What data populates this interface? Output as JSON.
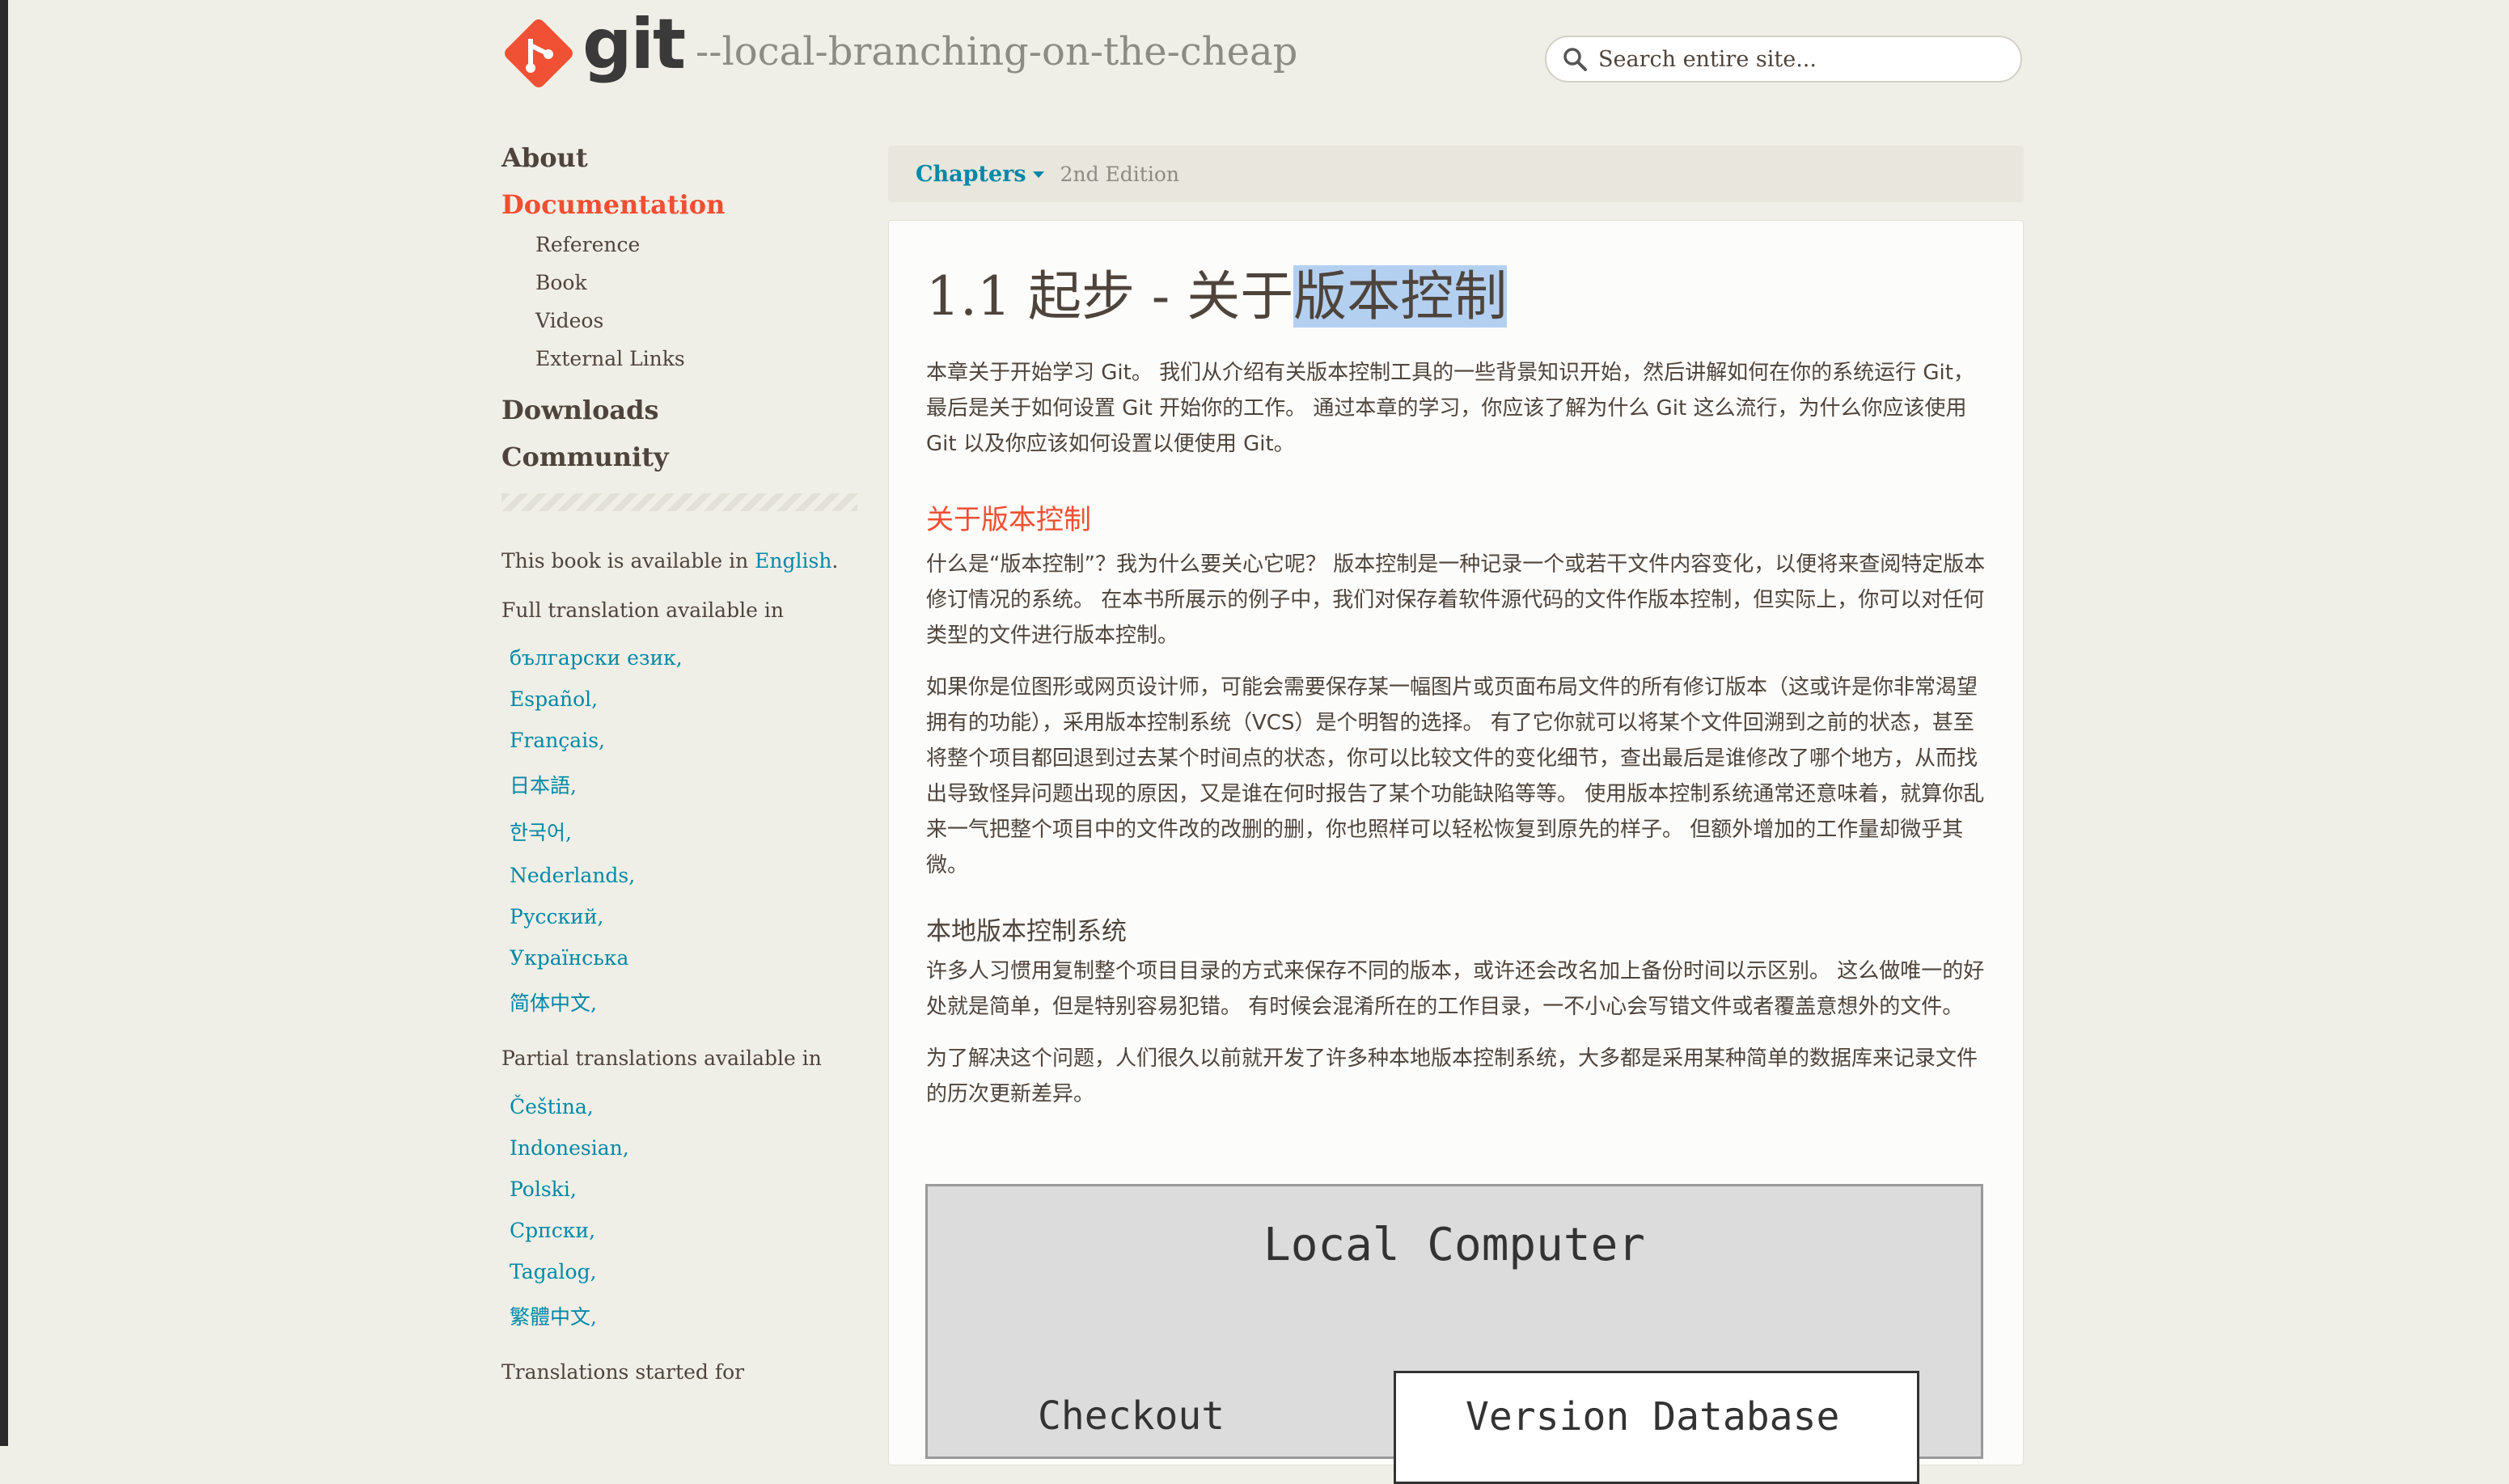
{
  "brand": {
    "logo_text": "git",
    "tagline": "--local-branching-on-the-cheap",
    "accent": "#f14e32",
    "link": "#0388a6"
  },
  "search": {
    "placeholder": "Search entire site..."
  },
  "sidebar": {
    "nav": [
      {
        "label": "About"
      },
      {
        "label": "Documentation",
        "active": true
      },
      {
        "label": "Downloads"
      },
      {
        "label": "Community"
      }
    ],
    "doc_sub": [
      "Reference",
      "Book",
      "Videos",
      "External Links"
    ],
    "available_text": "This book is available in ",
    "available_link": "English",
    "available_suffix": ".",
    "full_label": "Full translation available in",
    "full_langs": [
      "български език,",
      "Español,",
      "Français,",
      "日本語,",
      "한국어,",
      "Nederlands,",
      "Русский,",
      "Українська",
      "简体中文,"
    ],
    "partial_label": "Partial translations available in",
    "partial_langs": [
      "Čeština,",
      "Indonesian,",
      "Polski,",
      "Српски,",
      "Tagalog,",
      "繁體中文,"
    ],
    "started_label": "Translations started for"
  },
  "chapters": {
    "label": "Chapters",
    "edition": "2nd Edition"
  },
  "content": {
    "title_plain": "1.1 起步 - 关于",
    "title_selected": "版本控制",
    "intro": "本章关于开始学习 Git。 我们从介绍有关版本控制工具的一些背景知识开始，然后讲解如何在你的系统运行 Git，最后是关于如何设置 Git 开始你的工作。 通过本章的学习，你应该了解为什么 Git 这么流行，为什么你应该使用 Git 以及你应该如何设置以便使用 Git。",
    "section_title": "关于版本控制",
    "p1": "什么是“版本控制”？我为什么要关心它呢？ 版本控制是一种记录一个或若干文件内容变化，以便将来查阅特定版本修订情况的系统。 在本书所展示的例子中，我们对保存着软件源代码的文件作版本控制，但实际上，你可以对任何类型的文件进行版本控制。",
    "p2": "如果你是位图形或网页设计师，可能会需要保存某一幅图片或页面布局文件的所有修订版本（这或许是你非常渴望拥有的功能），采用版本控制系统（VCS）是个明智的选择。 有了它你就可以将某个文件回溯到之前的状态，甚至将整个项目都回退到过去某个时间点的状态，你可以比较文件的变化细节，查出最后是谁修改了哪个地方，从而找出导致怪异问题出现的原因，又是谁在何时报告了某个功能缺陷等等。 使用版本控制系统通常还意味着，就算你乱来一气把整个项目中的文件改的改删的删，你也照样可以轻松恢复到原先的样子。 但额外增加的工作量却微乎其微。",
    "sub_title": "本地版本控制系统",
    "p3": "许多人习惯用复制整个项目目录的方式来保存不同的版本，或许还会改名加上备份时间以示区别。 这么做唯一的好处就是简单，但是特别容易犯错。 有时候会混淆所在的工作目录，一不小心会写错文件或者覆盖意想外的文件。",
    "p4": "为了解决这个问题，人们很久以前就开发了许多种本地版本控制系统，大多都是采用某种简单的数据库来记录文件的历次更新差异。"
  },
  "diagram": {
    "title": "Local Computer",
    "checkout": "Checkout",
    "database": "Version Database"
  }
}
